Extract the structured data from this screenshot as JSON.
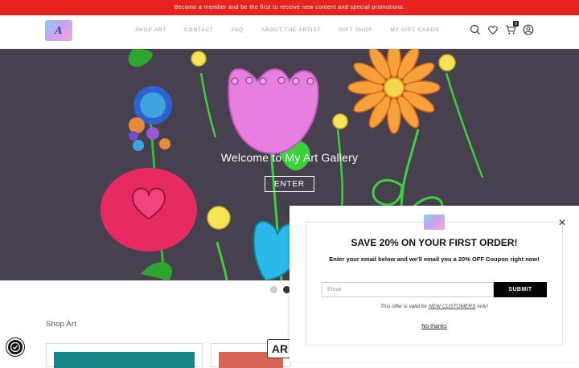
{
  "announcement": "Become a member and be the first to receive new content and special promotions.",
  "nav": {
    "items": [
      "SHOP ART",
      "CONTACT",
      "FAQ",
      "ABOUT THE ARTIST",
      "GIFT SHOP",
      "MY GIFT CARDS"
    ]
  },
  "header_icons": {
    "search": "search-icon",
    "wishlist": "heart-icon",
    "cart": "cart-icon",
    "cart_count": "0",
    "account": "user-icon"
  },
  "hero": {
    "title": "Welcome to My Art Gallery",
    "button": "ENTER"
  },
  "shop": {
    "title": "Shop Art"
  },
  "ar_badge": "AR",
  "popup": {
    "title": "SAVE 20% ON YOUR FIRST ORDER!",
    "subtitle": "Enter your email below and we'll email you a 20% OFF Coupon right now!",
    "email_placeholder": "Email",
    "submit": "SUBMIT",
    "offer_prefix": "This offer is valid for ",
    "offer_link": "NEW CUSTOMERS",
    "offer_suffix": " only!",
    "no_thanks": "No thanks"
  },
  "colors": {
    "announcement_bg": "#e8231f",
    "hero_bg": "#45404f"
  }
}
